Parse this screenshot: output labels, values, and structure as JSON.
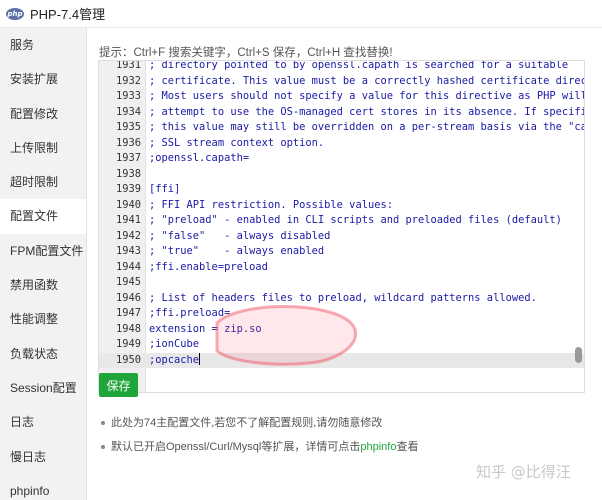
{
  "window": {
    "logo_text": "php",
    "title": "PHP-7.4管理"
  },
  "sidebar": {
    "items": [
      {
        "label": "服务"
      },
      {
        "label": "安装扩展"
      },
      {
        "label": "配置修改"
      },
      {
        "label": "上传限制"
      },
      {
        "label": "超时限制"
      },
      {
        "label": "配置文件",
        "active": true
      },
      {
        "label": "FPM配置文件"
      },
      {
        "label": "禁用函数"
      },
      {
        "label": "性能调整"
      },
      {
        "label": "负载状态"
      },
      {
        "label": "Session配置"
      },
      {
        "label": "日志"
      },
      {
        "label": "慢日志"
      },
      {
        "label": "phpinfo"
      }
    ]
  },
  "hint": "提示：Ctrl+F 搜索关键字，Ctrl+S 保存，Ctrl+H 查找替换!",
  "editor": {
    "lines": [
      {
        "num": "1931",
        "text": "; directory pointed to by openssl.capath is searched for a suitable"
      },
      {
        "num": "1932",
        "text": "; certificate. This value must be a correctly hashed certificate directory."
      },
      {
        "num": "1933",
        "text": "; Most users should not specify a value for this directive as PHP will"
      },
      {
        "num": "1934",
        "text": "; attempt to use the OS-managed cert stores in its absence. If specified,"
      },
      {
        "num": "1935",
        "text": "; this value may still be overridden on a per-stream basis via the \"capath\""
      },
      {
        "num": "1936",
        "text": "; SSL stream context option."
      },
      {
        "num": "1937",
        "text": ";openssl.capath="
      },
      {
        "num": "1938",
        "text": ""
      },
      {
        "num": "1939",
        "text": "[ffi]"
      },
      {
        "num": "1940",
        "text": "; FFI API restriction. Possible values:"
      },
      {
        "num": "1941",
        "text": "; \"preload\" - enabled in CLI scripts and preloaded files (default)"
      },
      {
        "num": "1942",
        "text": "; \"false\"   - always disabled"
      },
      {
        "num": "1943",
        "text": "; \"true\"    - always enabled"
      },
      {
        "num": "1944",
        "text": ";ffi.enable=preload"
      },
      {
        "num": "1945",
        "text": ""
      },
      {
        "num": "1946",
        "text": "; List of headers files to preload, wildcard patterns allowed."
      },
      {
        "num": "1947",
        "text": ";ffi.preload="
      },
      {
        "num": "1948",
        "text": "extension = zip.so"
      },
      {
        "num": "1949",
        "text": ";ionCube"
      },
      {
        "num": "1950",
        "text": ";opcache",
        "current": true
      }
    ]
  },
  "save_label": "保存",
  "notes": {
    "note1": "此处为74主配置文件,若您不了解配置规则,请勿随意修改",
    "note2_prefix": "默认已开启Openssl/Curl/Mysql等扩展，详情可点击",
    "note2_link": "phpinfo",
    "note2_suffix": "查看"
  },
  "watermark": "知乎 @比得汪",
  "colors": {
    "accent": "#20a53a",
    "code_text": "#1a1aa6",
    "highlight": "#e8e8e8"
  }
}
